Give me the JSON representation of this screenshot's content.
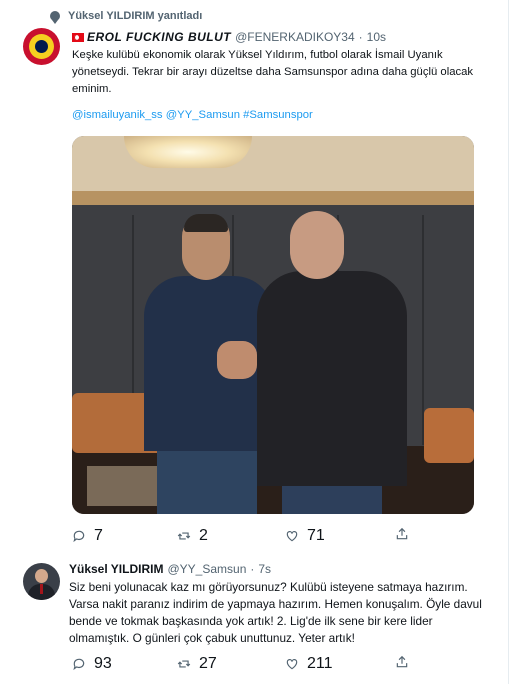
{
  "context": {
    "text": "Yüksel YILDIRIM yanıtladı"
  },
  "tweet1": {
    "display_name": "EROL FUCKING BULUT",
    "handle": "@FENERKADIKOY34",
    "separator": "·",
    "time": "10s",
    "text": "Keşke kulübü ekonomik olarak Yüksel Yıldırım, futbol olarak İsmail Uyanık yönetseydi. Tekrar bir arayı düzeltse daha Samsunspor adına daha güçlü olacak eminim.",
    "tags": "@ismailuyanik_ss @YY_Samsun #Samsunspor",
    "replies": "7",
    "retweets": "2",
    "likes": "71"
  },
  "tweet2": {
    "display_name": "Yüksel YILDIRIM",
    "handle": "@YY_Samsun",
    "separator": "·",
    "time": "7s",
    "text": "Siz beni yolunacak kaz mı görüyorsunuz? Kulübü isteyene satmaya hazırım. Varsa nakit paranız indirim de yapmaya hazırım. Hemen konuşalım. Öyle davul bende ve tokmak başkasında yok artık! 2. Lig'de ilk sene bir kere lider olmamıştık. O günleri çok çabuk unuttunuz. Yeter artık!",
    "replies": "93",
    "retweets": "27",
    "likes": "211"
  },
  "colors": {
    "accent": "#1d9bf0",
    "muted": "#536471",
    "text": "#0f1419"
  },
  "icons": [
    "reply-icon",
    "retweet-icon",
    "like-icon",
    "share-icon"
  ]
}
